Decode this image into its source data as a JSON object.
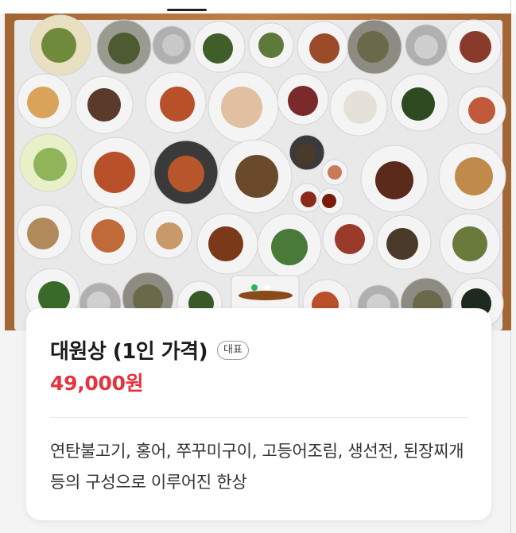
{
  "menu_item": {
    "image_alt": "",
    "title": "대원상 (1인 가격)",
    "badge": "대표",
    "price": "49,000원",
    "description": "연탄불고기, 홍어, 쭈꾸미구이, 고등어조림, 생선전, 된장찌개 등의 구성으로 이루어진 한상"
  },
  "carousel": {
    "total_slides": 2,
    "active_index": 0
  },
  "colors": {
    "price": "#e5333f",
    "active_dot": "#2bb15c",
    "table_wood": "#b7763d",
    "tablecloth": "#e9e9e9"
  }
}
